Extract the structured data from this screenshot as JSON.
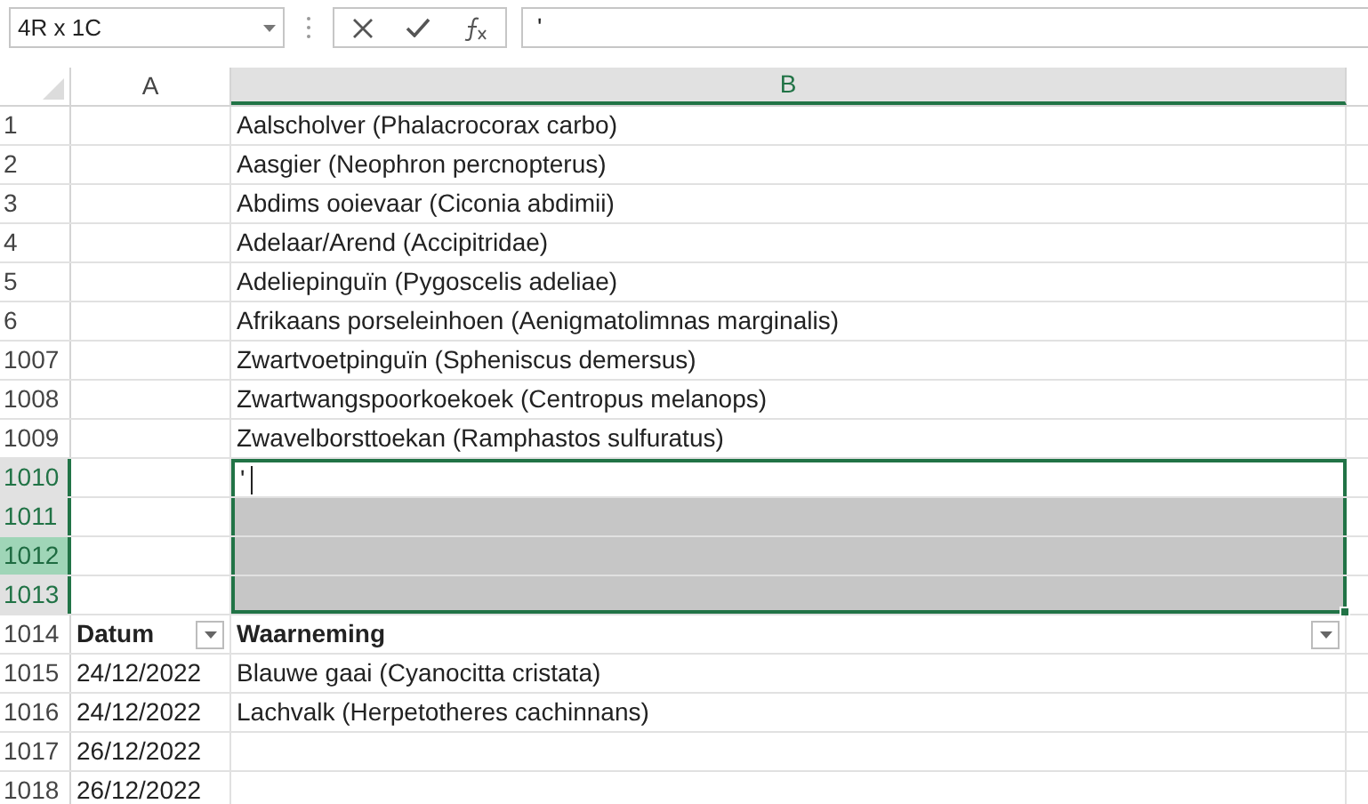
{
  "name_box": {
    "value": "4R x 1C"
  },
  "formula_bar": {
    "value": "'"
  },
  "columns": [
    {
      "label": "A",
      "selected": false
    },
    {
      "label": "B",
      "selected": true
    }
  ],
  "rows": [
    {
      "header": "1",
      "kind": "data",
      "selected": false,
      "active": false,
      "cells": [
        "",
        "Aalscholver (Phalacrocorax carbo)"
      ]
    },
    {
      "header": "2",
      "kind": "data",
      "selected": false,
      "active": false,
      "cells": [
        "",
        "Aasgier (Neophron percnopterus)"
      ]
    },
    {
      "header": "3",
      "kind": "data",
      "selected": false,
      "active": false,
      "cells": [
        "",
        "Abdims ooievaar (Ciconia abdimii)"
      ]
    },
    {
      "header": "4",
      "kind": "data",
      "selected": false,
      "active": false,
      "cells": [
        "",
        "Adelaar/Arend (Accipitridae)"
      ]
    },
    {
      "header": "5",
      "kind": "data",
      "selected": false,
      "active": false,
      "cells": [
        "",
        "Adeliepinguïn (Pygoscelis adeliae)"
      ]
    },
    {
      "header": "6",
      "kind": "data",
      "selected": false,
      "active": false,
      "cells": [
        "",
        "Afrikaans porseleinhoen (Aenigmatolimnas marginalis)"
      ]
    },
    {
      "header": "1007",
      "kind": "data",
      "selected": false,
      "active": false,
      "cells": [
        "",
        "Zwartvoetpinguïn (Spheniscus demersus)"
      ]
    },
    {
      "header": "1008",
      "kind": "data",
      "selected": false,
      "active": false,
      "cells": [
        "",
        "Zwartwangspoorkoekoek (Centropus melanops)"
      ]
    },
    {
      "header": "1009",
      "kind": "data",
      "selected": false,
      "active": false,
      "cells": [
        "",
        "Zwavelborsttoekan (Ramphastos sulfuratus)"
      ]
    },
    {
      "header": "1010",
      "kind": "editing",
      "selected": true,
      "active": false,
      "cells": [
        "",
        "'"
      ]
    },
    {
      "header": "1011",
      "kind": "shaded",
      "selected": true,
      "active": false,
      "cells": [
        "",
        ""
      ]
    },
    {
      "header": "1012",
      "kind": "shaded",
      "selected": true,
      "active": true,
      "cells": [
        "",
        ""
      ]
    },
    {
      "header": "1013",
      "kind": "shaded",
      "selected": true,
      "active": false,
      "cells": [
        "",
        ""
      ]
    },
    {
      "header": "1014",
      "kind": "table_header",
      "selected": false,
      "active": false,
      "cells": [
        "Datum",
        "Waarneming"
      ]
    },
    {
      "header": "1015",
      "kind": "data",
      "selected": false,
      "active": false,
      "cells": [
        "24/12/2022",
        "Blauwe gaai (Cyanocitta cristata)"
      ]
    },
    {
      "header": "1016",
      "kind": "data",
      "selected": false,
      "active": false,
      "cells": [
        "24/12/2022",
        "Lachvalk (Herpetotheres cachinnans)"
      ]
    },
    {
      "header": "1017",
      "kind": "data",
      "selected": false,
      "active": false,
      "cells": [
        "26/12/2022",
        ""
      ]
    },
    {
      "header": "1018",
      "kind": "data",
      "selected": false,
      "active": false,
      "cells": [
        "26/12/2022",
        ""
      ]
    }
  ]
}
